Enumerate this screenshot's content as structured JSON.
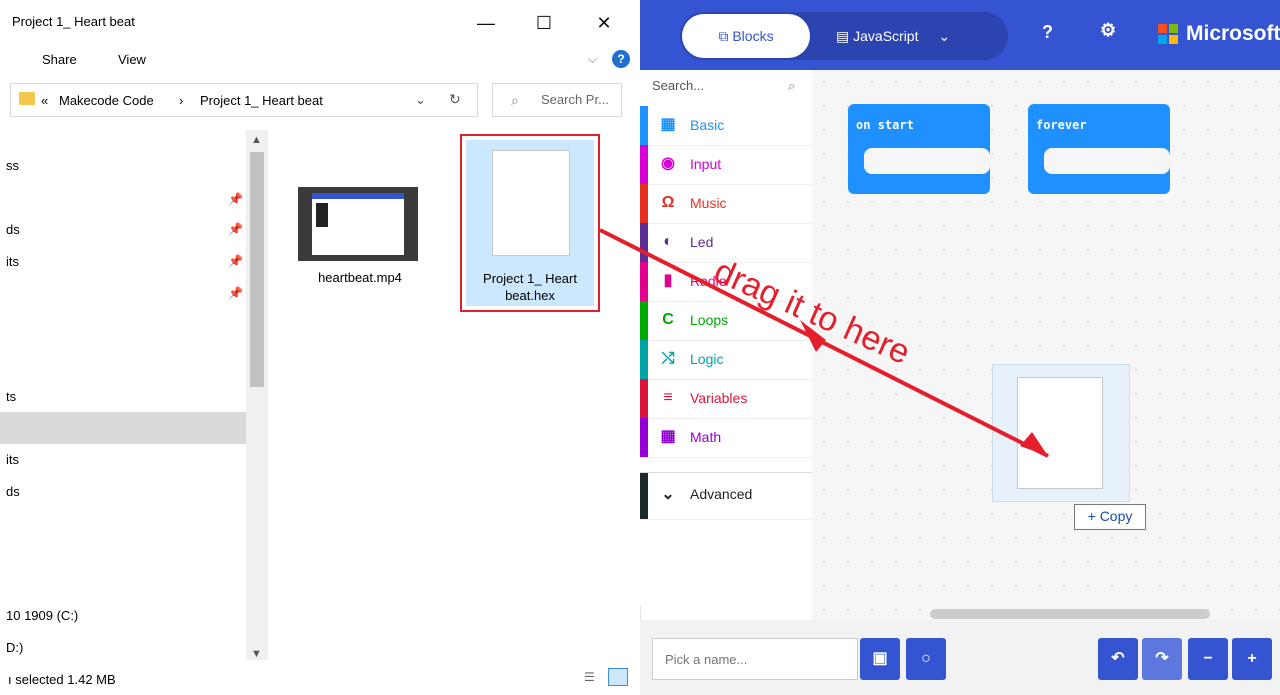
{
  "explorer": {
    "title": "Project 1_ Heart beat",
    "controls": {
      "minimize": "—",
      "maximize": "☐",
      "close": "✕"
    },
    "ribbon": {
      "share": "Share",
      "view": "View"
    },
    "address": {
      "prefix": "«",
      "path1": "Makecode Code",
      "sep": "›",
      "path2": "Project 1_ Heart beat"
    },
    "search_placeholder": "Search Pr...",
    "nav_fragments": [
      "ss",
      "ds",
      "its",
      "ts",
      "its",
      "ds",
      "10 1909 (C:)",
      "D:)"
    ],
    "files": [
      {
        "name": "heartbeat.mp4"
      },
      {
        "name_line1": "Project 1_ Heart",
        "name_line2": "beat.hex"
      }
    ],
    "status": "ı selected  1.42 MB"
  },
  "makecode": {
    "tabs": {
      "blocks": "Blocks",
      "javascript": "JavaScript"
    },
    "brand": "Microsoft",
    "search_placeholder": "Search...",
    "categories": [
      {
        "label": "Basic",
        "icon": "grid-icon",
        "color": "#1e90ff"
      },
      {
        "label": "Input",
        "icon": "target-icon",
        "color": "#d400d4"
      },
      {
        "label": "Music",
        "icon": "headphones-icon",
        "color": "#e63022"
      },
      {
        "label": "Led",
        "icon": "toggle-icon",
        "color": "#5c2d91"
      },
      {
        "label": "Radio",
        "icon": "signal-icon",
        "color": "#e3008c"
      },
      {
        "label": "Loops",
        "icon": "refresh-icon",
        "color": "#00aa00"
      },
      {
        "label": "Logic",
        "icon": "shuffle-icon",
        "color": "#00a4a6"
      },
      {
        "label": "Variables",
        "icon": "lines-icon",
        "color": "#dc143c"
      },
      {
        "label": "Math",
        "icon": "calculator-icon",
        "color": "#9400d3"
      }
    ],
    "advanced": "Advanced",
    "blocks": {
      "on_start": "on start",
      "forever": "forever"
    },
    "copy_tag": "+ Copy",
    "name_placeholder": "Pick a name..."
  },
  "annotation": "drag it to here"
}
